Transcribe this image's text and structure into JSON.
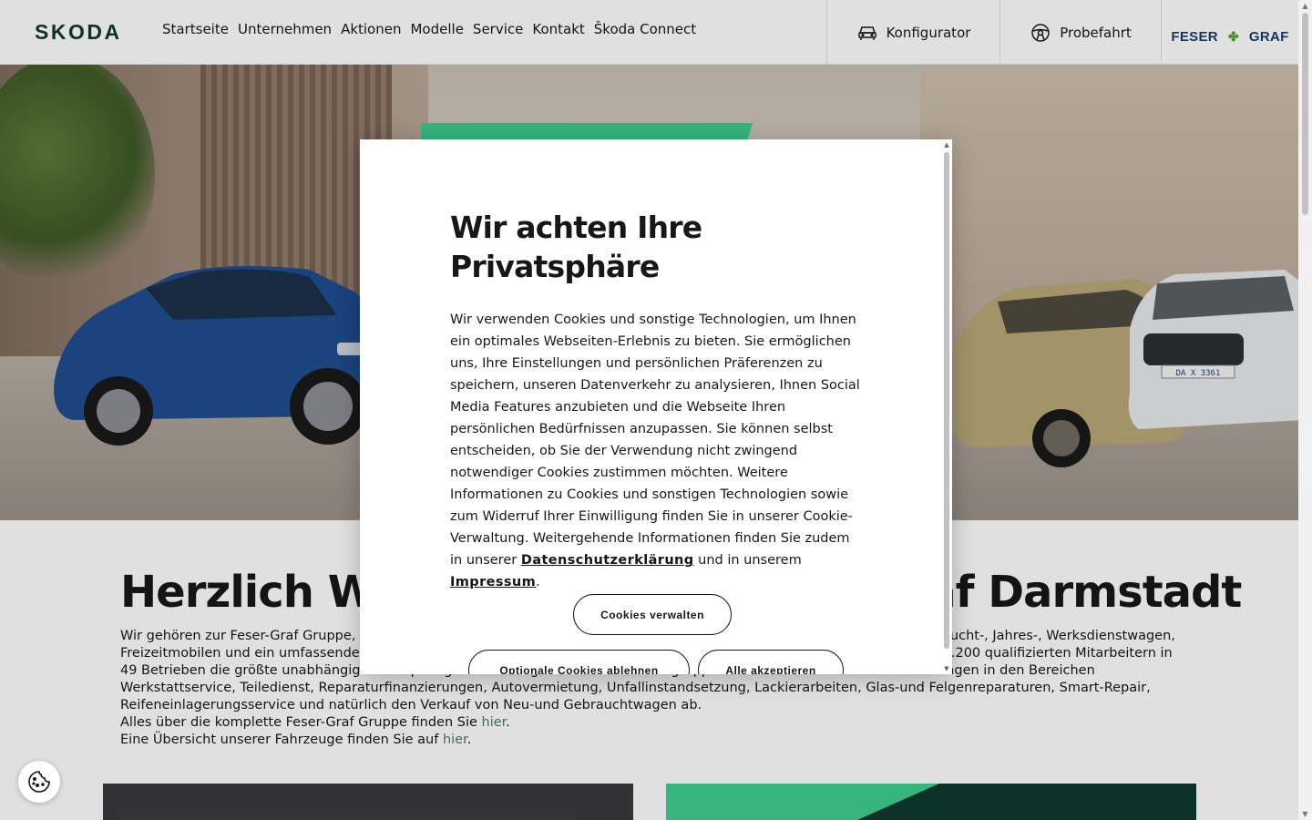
{
  "header": {
    "brand": "SKODA",
    "nav": [
      "Startseite",
      "Unternehmen",
      "Aktionen",
      "Modelle",
      "Service",
      "Kontakt",
      "Škoda Connect"
    ],
    "configurator_label": "Konfigurator",
    "testdrive_label": "Probefahrt",
    "dealer_logo_left": "FESER",
    "dealer_logo_right": "GRAF"
  },
  "hero": {
    "plate": "DA X 3361"
  },
  "welcome": {
    "title": "Herzlich Willkommen bei Feser-Graf Darmstadt",
    "text_line1": "Wir gehören zur Feser-Graf Gruppe, einer der größten Automobilhandelsgruppen Deutschlands. Wir bieten Ihnen Neu-, Gebraucht-, Jahres-, Werksdienstwagen, Freizeitmobilen und ein umfassendes Angebot an Serviceleistungen. Das inhabergeführte Familienunternehmen ist mitüber 2.200 qualifizierten Mitarbeitern in 49 Betrieben die größte unabhängige Metropolregion Nürnberg. Die Unternehmensgruppe deckt auch sämtliche Dienstleistungen in den Bereichen Werkstattservice, Teiledienst, Reparaturfinanzierungen, Autovermietung, Unfallinstandsetzung, Lackierarbeiten, Glas-und Felgenreparaturen, Smart-Repair, Reifeneinlagerungsservice und natürlich den Verkauf von Neu-und Gebrauchtwagen ab.",
    "text_line2_prefix": "Alles über die komplette Feser-Graf Gruppe finden Sie ",
    "text_line3_prefix": "Eine Übersicht unserer Fahrzeuge finden Sie auf ",
    "link_here": "hier",
    "period": "."
  },
  "cookie_modal": {
    "title": "Wir achten Ihre Privatsphäre",
    "body": "Wir verwenden Cookies und sonstige Technologien, um Ihnen ein optimales Webseiten-Erlebnis zu bieten. Sie ermöglichen uns, Ihre Einstellungen und persönlichen Präferenzen zu speichern, unseren Datenverkehr zu analysieren, Ihnen Social Media Features anzubieten und die Webseite Ihren persönlichen Bedürfnissen anzupassen. Sie können selbst entscheiden, ob Sie der Verwendung nicht zwingend notwendiger Cookies zustimmen möchten. Weitere Informationen zu Cookies und sonstigen Technologien sowie zum Widerruf Ihrer Einwilligung finden Sie in unserer Cookie-Verwaltung. Weitergehende Informationen finden Sie zudem in unserer ",
    "privacy_link": "Datenschutzerklärung",
    "body_mid": " und in unserem ",
    "imprint_link": "Impressum",
    "body_end": ".",
    "manage_button": "Cookies verwalten",
    "decline_button": "Optionale Cookies ablehnen",
    "accept_button": "Alle akzeptieren"
  },
  "icons": {
    "configurator": "car-icon",
    "testdrive": "steering-wheel-icon",
    "cookie_settings": "cookie-icon"
  },
  "colors": {
    "brand_green": "#0e3a2f",
    "accent_green": "#3ecf8e",
    "dealer_blue": "#1a3d6b"
  }
}
